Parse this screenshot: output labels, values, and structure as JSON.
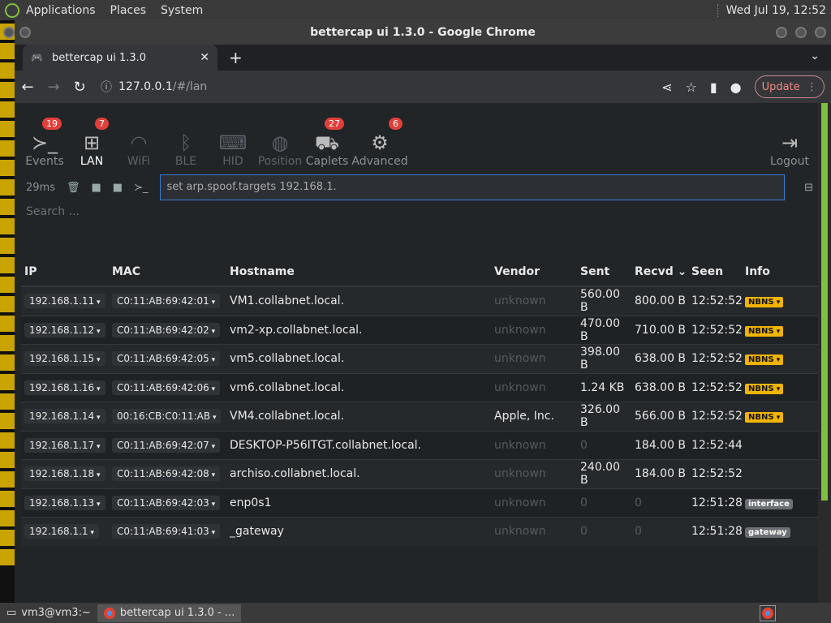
{
  "top_panel": {
    "menus": [
      "Applications",
      "Places",
      "System"
    ],
    "clock": "Wed Jul 19, 12:52"
  },
  "window": {
    "title": "bettercap ui 1.3.0 - Google Chrome",
    "tab_title": "bettercap ui 1.3.0",
    "url_host": "127.0.0.1",
    "url_path": "/#/lan",
    "update_label": "Update"
  },
  "nav": {
    "items": [
      {
        "label": "Events",
        "badge": "19",
        "icon": "terminal-icon"
      },
      {
        "label": "LAN",
        "badge": "7",
        "icon": "network-icon"
      },
      {
        "label": "WiFi",
        "badge": "",
        "icon": "wifi-icon"
      },
      {
        "label": "BLE",
        "badge": "",
        "icon": "bluetooth-icon"
      },
      {
        "label": "HID",
        "badge": "",
        "icon": "keyboard-icon"
      },
      {
        "label": "Position",
        "badge": "",
        "icon": "globe-icon"
      },
      {
        "label": "Caplets",
        "badge": "27",
        "icon": "cart-icon"
      },
      {
        "label": "Advanced",
        "badge": "6",
        "icon": "gears-icon"
      }
    ],
    "logout": "Logout"
  },
  "cmd": {
    "latency": "29ms",
    "value": "set arp.spoof.targets 192.168.1.",
    "search_placeholder": "Search ..."
  },
  "table": {
    "headers": {
      "ip": "IP",
      "mac": "MAC",
      "hostname": "Hostname",
      "vendor": "Vendor",
      "sent": "Sent",
      "recvd": "Recvd",
      "seen": "Seen",
      "info": "Info"
    },
    "rows": [
      {
        "ip": "192.168.1.11",
        "mac": "C0:11:AB:69:42:01",
        "host": "VM1.collabnet.local.",
        "vendor": "unknown",
        "sent": "560.00 B",
        "recvd": "800.00 B",
        "seen": "12:52:52",
        "info": "NBNS"
      },
      {
        "ip": "192.168.1.12",
        "mac": "C0:11:AB:69:42:02",
        "host": "vm2-xp.collabnet.local.",
        "vendor": "unknown",
        "sent": "470.00 B",
        "recvd": "710.00 B",
        "seen": "12:52:52",
        "info": "NBNS"
      },
      {
        "ip": "192.168.1.15",
        "mac": "C0:11:AB:69:42:05",
        "host": "vm5.collabnet.local.",
        "vendor": "unknown",
        "sent": "398.00 B",
        "recvd": "638.00 B",
        "seen": "12:52:52",
        "info": "NBNS"
      },
      {
        "ip": "192.168.1.16",
        "mac": "C0:11:AB:69:42:06",
        "host": "vm6.collabnet.local.",
        "vendor": "unknown",
        "sent": "1.24 KB",
        "recvd": "638.00 B",
        "seen": "12:52:52",
        "info": "NBNS"
      },
      {
        "ip": "192.168.1.14",
        "mac": "00:16:CB:C0:11:AB",
        "host": "VM4.collabnet.local.",
        "vendor": "Apple, Inc.",
        "sent": "326.00 B",
        "recvd": "566.00 B",
        "seen": "12:52:52",
        "info": "NBNS"
      },
      {
        "ip": "192.168.1.17",
        "mac": "C0:11:AB:69:42:07",
        "host": "DESKTOP-P56ITGT.collabnet.local.",
        "vendor": "unknown",
        "sent": "0",
        "recvd": "184.00 B",
        "seen": "12:52:44",
        "info": ""
      },
      {
        "ip": "192.168.1.18",
        "mac": "C0:11:AB:69:42:08",
        "host": "archiso.collabnet.local.",
        "vendor": "unknown",
        "sent": "240.00 B",
        "recvd": "184.00 B",
        "seen": "12:52:52",
        "info": ""
      },
      {
        "ip": "192.168.1.13",
        "mac": "C0:11:AB:69:42:03",
        "host": "enp0s1",
        "vendor": "unknown",
        "sent": "0",
        "recvd": "0",
        "seen": "12:51:28",
        "info": "interface"
      },
      {
        "ip": "192.168.1.1",
        "mac": "C0:11:AB:69:41:03",
        "host": "_gateway",
        "vendor": "unknown",
        "sent": "0",
        "recvd": "0",
        "seen": "12:51:28",
        "info": "gateway"
      }
    ]
  },
  "taskbar": {
    "items": [
      "vm3@vm3:~",
      "bettercap ui 1.3.0 - ..."
    ]
  }
}
